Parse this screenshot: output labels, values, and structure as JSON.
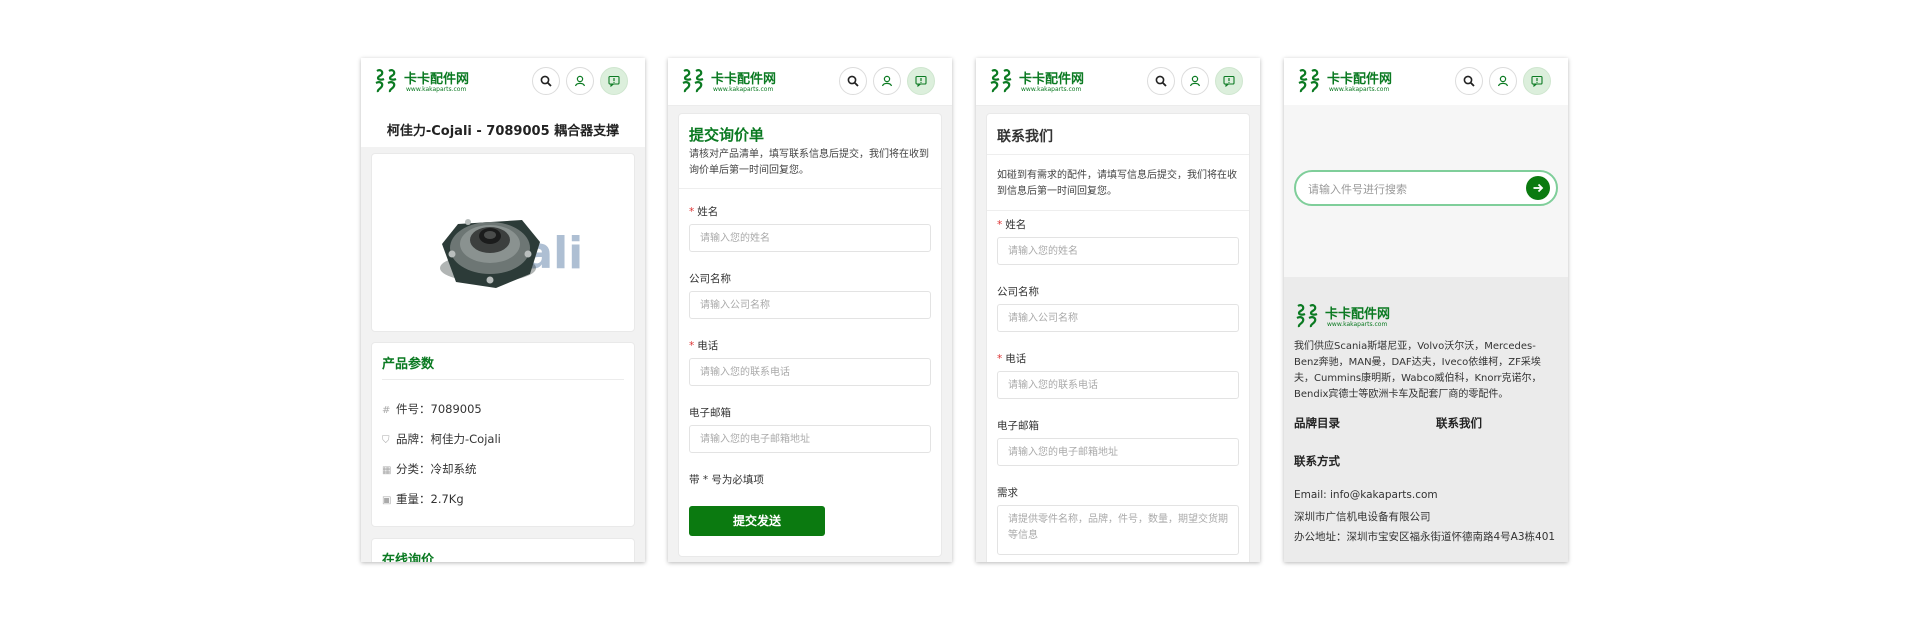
{
  "brand": {
    "name": "卡卡配件网",
    "url": "www.kakaparts.com",
    "color": "#0b7a22"
  },
  "header_icons": [
    "search-icon",
    "user-icon",
    "message-icon"
  ],
  "product": {
    "title": "柯佳力-Cojali - 7089005 耦合器支撑",
    "image_watermark": "cojali",
    "params_title": "产品参数",
    "params": [
      {
        "icon": "hash-icon",
        "text": "件号：7089005"
      },
      {
        "icon": "tag-icon",
        "text": "品牌：柯佳力-Cojali"
      },
      {
        "icon": "grid-icon",
        "text": "分类：冷却系统"
      },
      {
        "icon": "weight-icon",
        "text": "重量：2.7Kg"
      }
    ],
    "inquiry_title": "在线询价"
  },
  "inquiry_form": {
    "title": "提交询价单",
    "description": "请核对产品清单，填写联系信息后提交，我们将在收到询价单后第一时间回复您。",
    "fields": [
      {
        "label": "姓名",
        "required": true,
        "placeholder": "请输入您的姓名"
      },
      {
        "label": "公司名称",
        "required": false,
        "placeholder": "请输入公司名称"
      },
      {
        "label": "电话",
        "required": true,
        "placeholder": "请输入您的联系电话"
      },
      {
        "label": "电子邮箱",
        "required": false,
        "placeholder": "请输入您的电子邮箱地址"
      }
    ],
    "required_note": "带 * 号为必填项",
    "submit": "提交发送"
  },
  "contact_form": {
    "title": "联系我们",
    "description": "如碰到有需求的配件，请填写信息后提交，我们将在收到信息后第一时间回复您。",
    "fields": [
      {
        "label": "姓名",
        "required": true,
        "placeholder": "请输入您的姓名"
      },
      {
        "label": "公司名称",
        "required": false,
        "placeholder": "请输入公司名称"
      },
      {
        "label": "电话",
        "required": true,
        "placeholder": "请输入您的联系电话"
      },
      {
        "label": "电子邮箱",
        "required": false,
        "placeholder": "请输入您的电子邮箱地址"
      }
    ],
    "demand_label": "需求",
    "demand_placeholder": "请提供零件名称，品牌，件号，数量，期望交货期等信息"
  },
  "home": {
    "search_placeholder": "请输入件号进行搜索",
    "about": "我们供应Scania斯堪尼亚，Volvo沃尔沃，Mercedes-Benz奔驰，MAN曼，DAF达夫，Iveco依维柯，ZF采埃夫，Cummins康明斯，Wabco威伯科，Knorr克诺尔，Bendix宾德士等欧洲卡车及配套厂商的零配件。",
    "links": [
      "品牌目录",
      "联系我们"
    ],
    "contact_title": "联系方式",
    "contact_lines": [
      "Email: info@kakaparts.com",
      "深圳市广信机电设备有限公司",
      "办公地址：深圳市宝安区福永街道怀德南路4号A3栋401"
    ]
  },
  "colors": {
    "green": "#0b7a10",
    "required": "#dd3333",
    "search_border": "#7fce9a"
  }
}
